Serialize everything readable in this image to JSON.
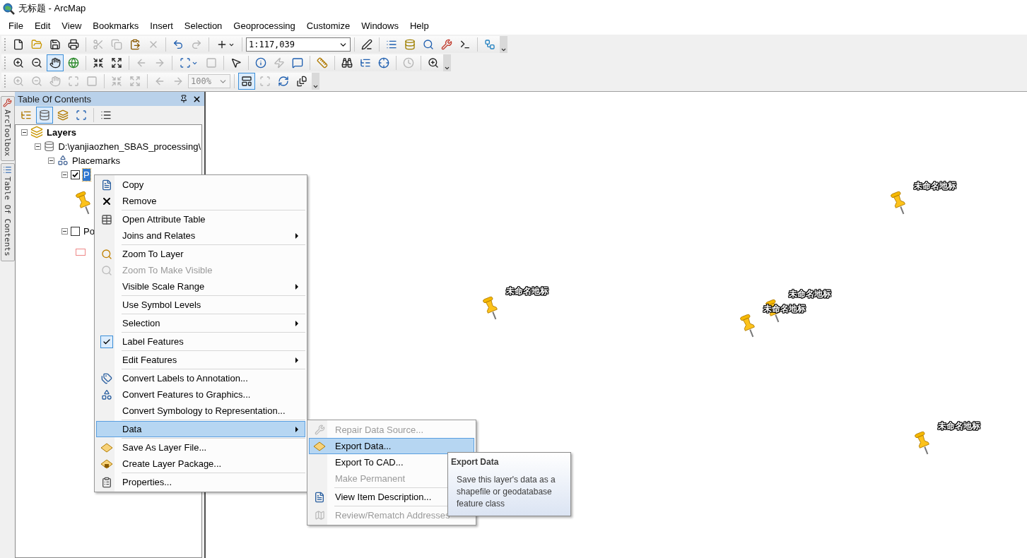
{
  "window": {
    "title": "无标题 - ArcMap"
  },
  "menu_bar": [
    "File",
    "Edit",
    "View",
    "Bookmarks",
    "Insert",
    "Selection",
    "Geoprocessing",
    "Customize",
    "Windows",
    "Help"
  ],
  "toolbars": [
    {
      "items": [
        {
          "kind": "button",
          "disabled": false,
          "pressed": false
        },
        {
          "kind": "button",
          "disabled": false,
          "pressed": false
        },
        {
          "kind": "button",
          "disabled": false,
          "pressed": false
        },
        {
          "kind": "button",
          "disabled": false,
          "pressed": false
        },
        {
          "kind": "separator"
        },
        {
          "kind": "button",
          "disabled": true,
          "pressed": false
        },
        {
          "kind": "button",
          "disabled": true,
          "pressed": false
        },
        {
          "kind": "button",
          "disabled": false,
          "pressed": false
        },
        {
          "kind": "button",
          "disabled": true,
          "pressed": false
        },
        {
          "kind": "separator"
        },
        {
          "kind": "button",
          "disabled": false,
          "pressed": false
        },
        {
          "kind": "button",
          "disabled": true,
          "pressed": false
        },
        {
          "kind": "separator"
        },
        {
          "kind": "dropdown",
          "disabled": false,
          "pressed": false
        },
        {
          "kind": "separator"
        },
        {
          "kind": "field",
          "value": "1:117,039",
          "disabled": false
        },
        {
          "kind": "separator"
        },
        {
          "kind": "button",
          "disabled": false,
          "pressed": false
        },
        {
          "kind": "separator"
        },
        {
          "kind": "button",
          "disabled": false,
          "pressed": false
        },
        {
          "kind": "button",
          "disabled": false,
          "pressed": false
        },
        {
          "kind": "button",
          "disabled": false,
          "pressed": false
        },
        {
          "kind": "button",
          "disabled": false,
          "pressed": false
        },
        {
          "kind": "button",
          "disabled": false,
          "pressed": false
        },
        {
          "kind": "separator"
        },
        {
          "kind": "button",
          "disabled": false,
          "pressed": false
        },
        {
          "kind": "overflow"
        }
      ]
    },
    {
      "items": [
        {
          "kind": "button",
          "disabled": false,
          "pressed": false
        },
        {
          "kind": "button",
          "disabled": false,
          "pressed": false
        },
        {
          "kind": "button",
          "disabled": false,
          "pressed": true
        },
        {
          "kind": "button",
          "disabled": false,
          "pressed": false
        },
        {
          "kind": "separator"
        },
        {
          "kind": "button",
          "disabled": false,
          "pressed": false
        },
        {
          "kind": "button",
          "disabled": false,
          "pressed": false
        },
        {
          "kind": "separator"
        },
        {
          "kind": "button",
          "disabled": true,
          "pressed": false
        },
        {
          "kind": "button",
          "disabled": true,
          "pressed": false
        },
        {
          "kind": "separator"
        },
        {
          "kind": "dropdown",
          "disabled": false,
          "pressed": false
        },
        {
          "kind": "button",
          "disabled": true,
          "pressed": false
        },
        {
          "kind": "separator"
        },
        {
          "kind": "button",
          "disabled": false,
          "pressed": false
        },
        {
          "kind": "separator"
        },
        {
          "kind": "button",
          "disabled": false,
          "pressed": false
        },
        {
          "kind": "button",
          "disabled": true,
          "pressed": false
        },
        {
          "kind": "button",
          "disabled": false,
          "pressed": false
        },
        {
          "kind": "separator"
        },
        {
          "kind": "button",
          "disabled": false,
          "pressed": false
        },
        {
          "kind": "separator"
        },
        {
          "kind": "button",
          "disabled": false,
          "pressed": false
        },
        {
          "kind": "button",
          "disabled": false,
          "pressed": false
        },
        {
          "kind": "button",
          "disabled": false,
          "pressed": false
        },
        {
          "kind": "separator"
        },
        {
          "kind": "button",
          "disabled": true,
          "pressed": false
        },
        {
          "kind": "separator"
        },
        {
          "kind": "button",
          "disabled": false,
          "pressed": false
        },
        {
          "kind": "overflow"
        }
      ]
    },
    {
      "items": [
        {
          "kind": "button",
          "disabled": true,
          "pressed": false
        },
        {
          "kind": "button",
          "disabled": true,
          "pressed": false
        },
        {
          "kind": "button",
          "disabled": true,
          "pressed": false
        },
        {
          "kind": "button",
          "disabled": true,
          "pressed": false
        },
        {
          "kind": "button",
          "disabled": true,
          "pressed": false
        },
        {
          "kind": "separator"
        },
        {
          "kind": "button",
          "disabled": true,
          "pressed": false
        },
        {
          "kind": "button",
          "disabled": true,
          "pressed": false
        },
        {
          "kind": "separator"
        },
        {
          "kind": "button",
          "disabled": true,
          "pressed": false
        },
        {
          "kind": "button",
          "disabled": true,
          "pressed": false
        },
        {
          "kind": "field",
          "value": "100%",
          "disabled": true
        },
        {
          "kind": "separator"
        },
        {
          "kind": "button",
          "disabled": false,
          "pressed": true
        },
        {
          "kind": "button",
          "disabled": true,
          "pressed": false
        },
        {
          "kind": "button",
          "disabled": false,
          "pressed": false
        },
        {
          "kind": "button",
          "disabled": false,
          "pressed": false
        },
        {
          "kind": "overflow"
        }
      ]
    }
  ],
  "side_tabs": [
    "ArcToolbox",
    "Table Of Contents"
  ],
  "toc": {
    "title": "Table Of Contents",
    "tools": [
      {
        "selected": false
      },
      {
        "selected": true
      },
      {
        "selected": false
      },
      {
        "selected": false
      },
      {
        "selected": false
      }
    ],
    "tree": [
      {
        "kind": "frame",
        "label": "Layers",
        "expanded": true,
        "children": [
          {
            "kind": "database",
            "label": "D:\\yanjiaozhen_SBAS_processing\\",
            "expanded": true,
            "children": [
              {
                "kind": "group",
                "label": "Placemarks",
                "expanded": true,
                "children": [
                  {
                    "kind": "layer",
                    "label": "P",
                    "expanded": true,
                    "checked": true,
                    "selected": true,
                    "legend": {
                      "kind": "pin"
                    }
                  },
                  {
                    "kind": "layer",
                    "label": "Po",
                    "expanded": true,
                    "checked": false,
                    "selected": false,
                    "legend": {
                      "kind": "polygon"
                    }
                  }
                ]
              }
            ]
          }
        ]
      }
    ]
  },
  "context_menu": {
    "groups": [
      [
        {
          "label": "Copy",
          "disabled": false,
          "submenu": false,
          "checked": false,
          "selected": false
        },
        {
          "label": "Remove",
          "disabled": false,
          "submenu": false,
          "checked": false,
          "selected": false
        }
      ],
      [
        {
          "label": "Open Attribute Table",
          "disabled": false,
          "submenu": false,
          "checked": false,
          "selected": false
        },
        {
          "label": "Joins and Relates",
          "disabled": false,
          "submenu": true,
          "checked": false,
          "selected": false
        }
      ],
      [
        {
          "label": "Zoom To Layer",
          "disabled": false,
          "submenu": false,
          "checked": false,
          "selected": false
        },
        {
          "label": "Zoom To Make Visible",
          "disabled": true,
          "submenu": false,
          "checked": false,
          "selected": false
        },
        {
          "label": "Visible Scale Range",
          "disabled": false,
          "submenu": true,
          "checked": false,
          "selected": false
        }
      ],
      [
        {
          "label": "Use Symbol Levels",
          "disabled": false,
          "submenu": false,
          "checked": false,
          "selected": false
        }
      ],
      [
        {
          "label": "Selection",
          "disabled": false,
          "submenu": true,
          "checked": false,
          "selected": false
        }
      ],
      [
        {
          "label": "Label Features",
          "disabled": false,
          "submenu": false,
          "checked": true,
          "selected": false
        }
      ],
      [
        {
          "label": "Edit Features",
          "disabled": false,
          "submenu": true,
          "checked": false,
          "selected": false
        }
      ],
      [
        {
          "label": "Convert Labels to Annotation...",
          "disabled": false,
          "submenu": false,
          "checked": false,
          "selected": false
        },
        {
          "label": "Convert Features to Graphics...",
          "disabled": false,
          "submenu": false,
          "checked": false,
          "selected": false
        },
        {
          "label": "Convert Symbology to Representation...",
          "disabled": false,
          "submenu": false,
          "checked": false,
          "selected": false
        }
      ],
      [
        {
          "label": "Data",
          "disabled": false,
          "submenu": true,
          "checked": false,
          "selected": true
        }
      ],
      [
        {
          "label": "Save As Layer File...",
          "disabled": false,
          "submenu": false,
          "checked": false,
          "selected": false
        },
        {
          "label": "Create Layer Package...",
          "disabled": false,
          "submenu": false,
          "checked": false,
          "selected": false
        }
      ],
      [
        {
          "label": "Properties...",
          "disabled": false,
          "submenu": false,
          "checked": false,
          "selected": false
        }
      ]
    ]
  },
  "submenu": {
    "groups": [
      [
        {
          "label": "Repair Data Source...",
          "disabled": true,
          "selected": false
        },
        {
          "label": "Export Data...",
          "disabled": false,
          "selected": true
        },
        {
          "label": "Export To CAD...",
          "disabled": false,
          "selected": false
        },
        {
          "label": "Make Permanent",
          "disabled": true,
          "selected": false
        }
      ],
      [
        {
          "label": "View Item Description...",
          "disabled": false,
          "selected": false
        }
      ],
      [
        {
          "label": "Review/Rematch Addresses",
          "disabled": true,
          "selected": false
        }
      ]
    ]
  },
  "tooltip": {
    "title": "Export Data",
    "text": "Save this layer's data as a shapefile or geodatabase feature class"
  },
  "map": {
    "placemarks": [
      {
        "label": "未命名地标"
      },
      {
        "label": "未命名地标"
      },
      {
        "label": "未命名地标"
      },
      {
        "label": "未命名地标"
      },
      {
        "label": "未命名地标"
      }
    ]
  }
}
